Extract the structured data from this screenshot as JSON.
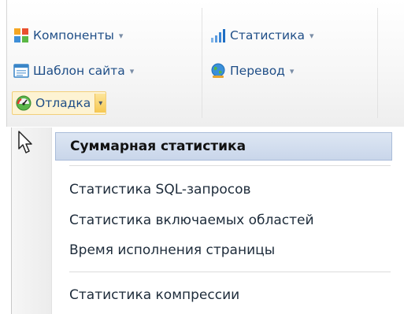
{
  "toolbar": {
    "components": {
      "label": "Компоненты",
      "icon": "components-icon"
    },
    "site_template": {
      "label": "Шаблон сайта",
      "icon": "site-template-icon"
    },
    "debug": {
      "label": "Отладка",
      "icon": "debug-gauge-icon"
    },
    "statistics": {
      "label": "Статистика",
      "icon": "statistics-chart-icon"
    },
    "translation": {
      "label": "Перевод",
      "icon": "translation-globe-icon"
    },
    "dropdown_arrow": "▾"
  },
  "debug_menu": {
    "items": [
      {
        "label": "Суммарная статистика",
        "hovered": true
      },
      {
        "label": "Статистика SQL-запросов"
      },
      {
        "label": "Статистика включаемых областей"
      },
      {
        "label": "Время исполнения страницы"
      },
      {
        "label": "Статистика компрессии"
      }
    ]
  },
  "colors": {
    "toolbar_text": "#1f4e87",
    "menu_hover_bg": "#c9d6ea",
    "active_button_bg": "#fdf3d3"
  }
}
